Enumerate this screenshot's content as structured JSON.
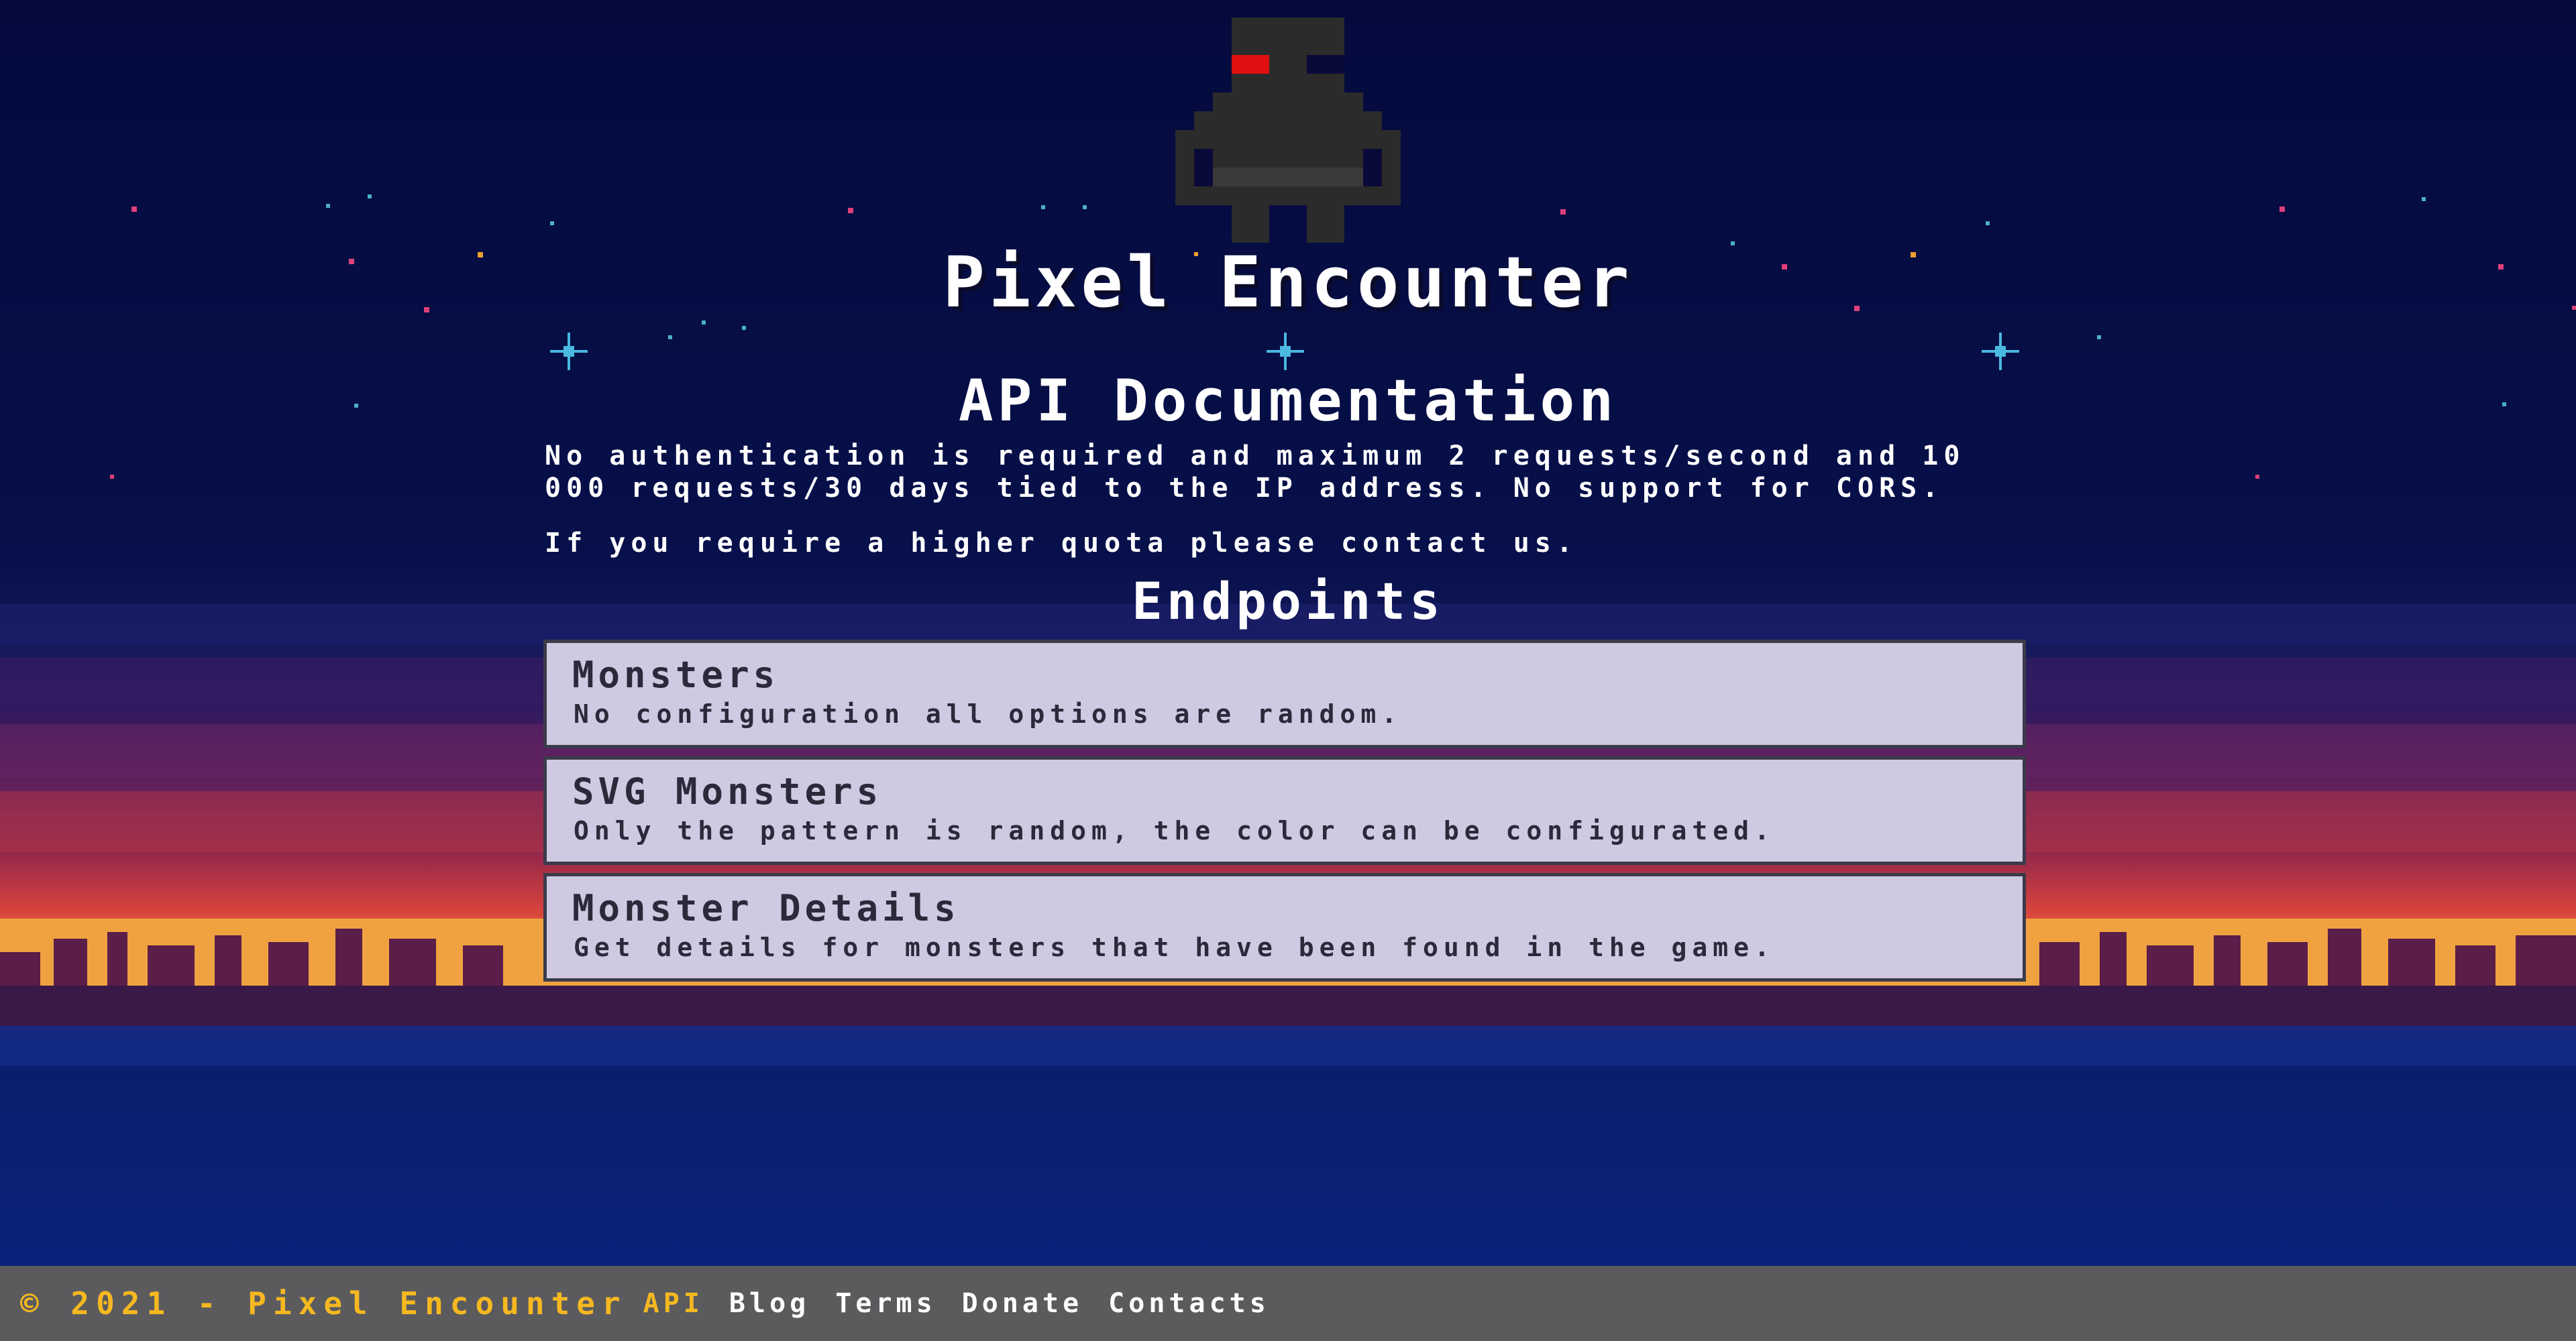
{
  "site": {
    "title": "Pixel Encounter"
  },
  "main": {
    "doc_title": "API Documentation",
    "intro_paragraph": "No authentication is required and maximum 2 requests/second and 10 000 requests/30 days tied to the IP address. No support for CORS.",
    "quota_paragraph": "If you require a higher quota please contact us.",
    "endpoints_title": "Endpoints",
    "endpoints": [
      {
        "name": "Monsters",
        "description": "No configuration all options are random."
      },
      {
        "name": "SVG Monsters",
        "description": "Only the pattern is random, the color can be configurated."
      },
      {
        "name": "Monster Details",
        "description": "Get details for monsters that have been found in the game."
      }
    ]
  },
  "footer": {
    "copyright": "© 2021 - Pixel Encounter",
    "links": [
      {
        "label": "API",
        "active": true
      },
      {
        "label": "Blog",
        "active": false
      },
      {
        "label": "Terms",
        "active": false
      },
      {
        "label": "Donate",
        "active": false
      },
      {
        "label": "Contacts",
        "active": false
      }
    ]
  },
  "colors": {
    "sky": "#040a3c",
    "accent": "#f5b820",
    "card_bg": "#cfc9e1",
    "card_border": "#3b3b4a",
    "footer_bg": "#5b5b5e",
    "mascot_eye": "#e01010"
  }
}
